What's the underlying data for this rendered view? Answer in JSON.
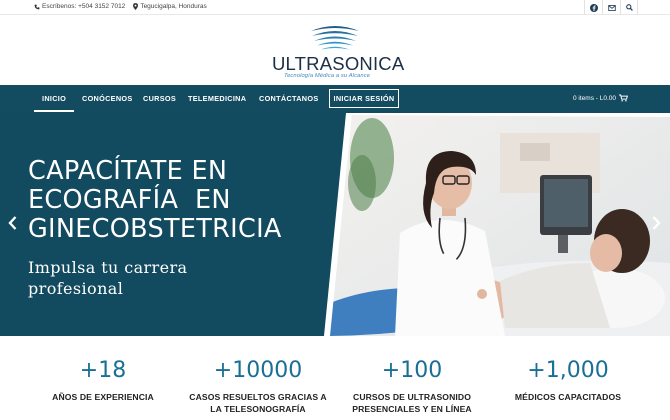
{
  "topbar": {
    "phone": "Escríbenos: +504 3152 7012",
    "location": "Tegucigalpa, Honduras",
    "icons": [
      "phone-icon",
      "map-pin-icon",
      "facebook-icon",
      "mail-icon",
      "search-icon"
    ]
  },
  "logo": {
    "brand": "ULTRASONICA",
    "tagline": "Tecnología Médica a su Alcance"
  },
  "nav": {
    "items": [
      "INICIO",
      "CONÓCENOS",
      "CURSOS",
      "TELEMEDICINA",
      "CONTÁCTANOS"
    ],
    "active": "INICIO",
    "login": "INICIAR SESIÓN",
    "cart": "0 items - L0.00"
  },
  "hero": {
    "title_lines": [
      "CAPACÍTATE EN",
      "ECOGRAFÍA  EN",
      "GINECOBSTETRICIA"
    ],
    "subtitle_lines": [
      "Impulsa tu carrera",
      "profesional"
    ]
  },
  "stats": [
    {
      "number": "+18",
      "label_lines": [
        "AÑOS DE EXPERIENCIA"
      ]
    },
    {
      "number": "+10000",
      "label_lines": [
        "CASOS RESUELTOS GRACIAS A",
        "LA TELESONOGRAFÍA"
      ]
    },
    {
      "number": "+100",
      "label_lines": [
        "CURSOS DE ULTRASONIDO",
        "PRESENCIALES Y EN LÍNEA"
      ]
    },
    {
      "number": "+1,000",
      "label_lines": [
        "MÉDICOS CAPACITADOS"
      ]
    }
  ],
  "colors": {
    "nav_bg": "#134b60",
    "hero_bg": "#124a5f",
    "accent": "#1a6f95",
    "brand_dark": "#1d2f47"
  }
}
